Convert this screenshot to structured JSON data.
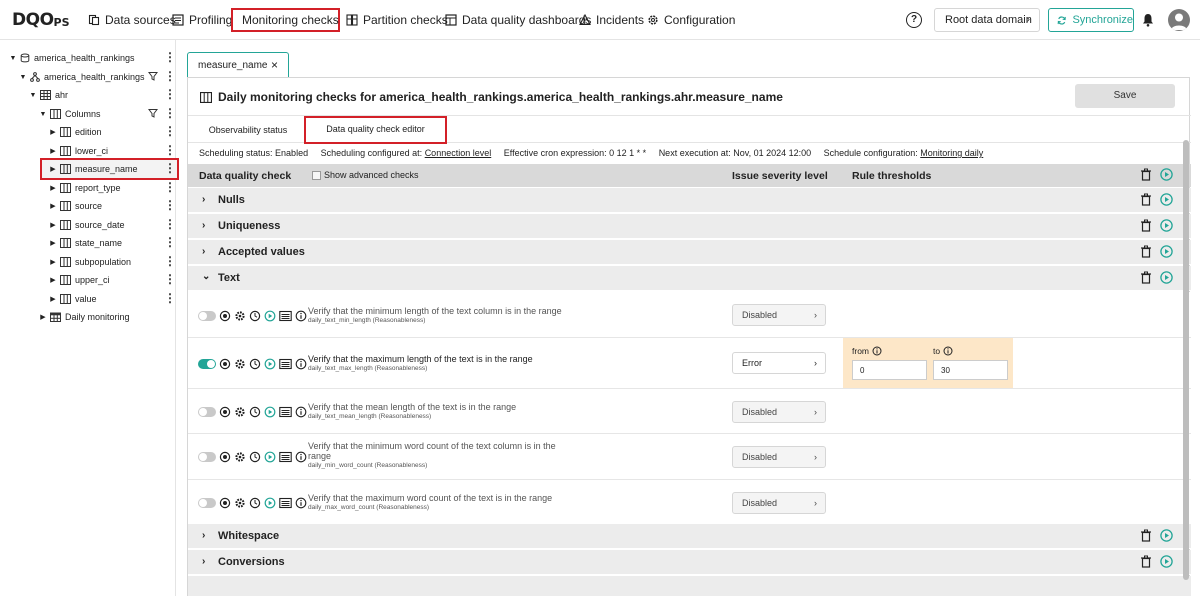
{
  "brand": {
    "logo_main": "DQO",
    "logo_sub": "PS"
  },
  "nav": {
    "data_sources": "Data sources",
    "profiling": "Profiling",
    "monitoring": "Monitoring checks",
    "partition": "Partition checks",
    "dashboards": "Data quality dashboards",
    "incidents": "Incidents",
    "configuration": "Configuration"
  },
  "header": {
    "help": "?",
    "root_domain": "Root data domain",
    "synchronize": "Synchronize"
  },
  "tree": {
    "connection": "america_health_rankings",
    "schema": "america_health_rankings",
    "table": "ahr",
    "columns_folder": "Columns",
    "columns": [
      "edition",
      "lower_ci",
      "measure_name",
      "report_type",
      "source",
      "source_date",
      "state_name",
      "subpopulation",
      "upper_ci",
      "value"
    ],
    "daily": "Daily monitoring"
  },
  "tab": {
    "label": "measure_name"
  },
  "panel": {
    "title": "Daily monitoring checks for america_health_rankings.america_health_rankings.ahr.measure_name",
    "save": "Save",
    "subtab_observability": "Observability status",
    "subtab_editor": "Data quality check editor"
  },
  "schedule": {
    "status": "Scheduling status: Enabled",
    "configured_prefix": "Scheduling configured at:",
    "configured_link": "Connection level",
    "cron": "Effective cron expression: 0 12 1 * *",
    "next": "Next execution at: Nov, 01 2024 12:00",
    "config_prefix": "Schedule configuration:",
    "config_link": "Monitoring daily"
  },
  "table_header": {
    "check": "Data quality check",
    "advanced": "Show advanced checks",
    "severity": "Issue severity level",
    "thresholds": "Rule thresholds"
  },
  "categories": [
    "Nulls",
    "Uniqueness",
    "Accepted values",
    "Text",
    "Whitespace",
    "Conversions"
  ],
  "checks": [
    {
      "title": "Verify that the minimum length of the text column is in the range",
      "name": "daily_text_min_length (Reasonableness)",
      "severity": "Disabled",
      "enabled": false
    },
    {
      "title": "Verify that the maximum length of the text is in the range",
      "name": "daily_text_max_length (Reasonableness)",
      "severity": "Error",
      "enabled": true
    },
    {
      "title": "Verify that the mean length of the text is in the range",
      "name": "daily_text_mean_length (Reasonableness)",
      "severity": "Disabled",
      "enabled": false
    },
    {
      "title": "Verify that the minimum word count of the text column is in the range",
      "name": "daily_min_word_count (Reasonableness)",
      "severity": "Disabled",
      "enabled": false
    },
    {
      "title": "Verify that the maximum word count of the text is in the range",
      "name": "daily_max_word_count (Reasonableness)",
      "severity": "Disabled",
      "enabled": false
    }
  ],
  "threshold": {
    "from_label": "from",
    "to_label": "to",
    "from_value": "0",
    "to_value": "30"
  },
  "colors": {
    "accent": "#23a597",
    "highlight": "#d32028",
    "threshold_bg": "#fde7c8"
  }
}
